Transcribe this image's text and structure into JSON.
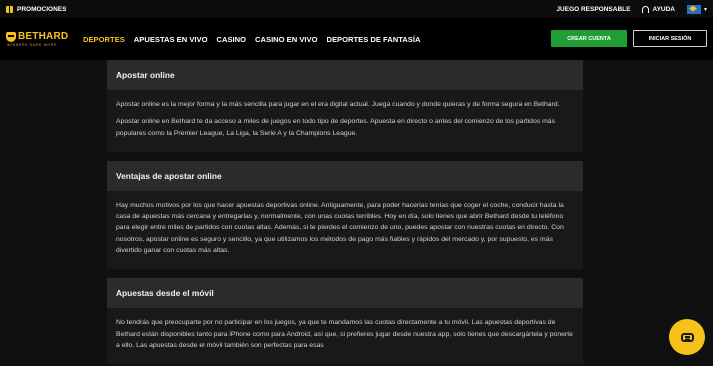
{
  "topbar": {
    "promo_label": "PROMOCIONES",
    "responsible_label": "JUEGO RESPONSABLE",
    "help_label": "AYUDA",
    "gift_icon": "gift-icon",
    "help_icon": "headset-icon",
    "language_icon": "flag-icon"
  },
  "brand": {
    "name": "BETHARD",
    "tagline": "WINNERS DARE MORE",
    "accent": "#f6c21a"
  },
  "nav": {
    "items": [
      {
        "label": "DEPORTES",
        "active": true
      },
      {
        "label": "APUESTAS EN VIVO",
        "active": false
      },
      {
        "label": "CASINO",
        "active": false
      },
      {
        "label": "CASINO EN VIVO",
        "active": false
      },
      {
        "label": "DEPORTES DE FANTASÍA",
        "active": false
      }
    ],
    "create_account_label": "CREAR CUENTA",
    "login_label": "INICIAR SESIÓN",
    "create_color": "#1f9e36"
  },
  "sections": [
    {
      "title": "Apostar online",
      "paragraphs": [
        "Apostar online es la mejor forma y la más sencilla para jugar en el era digital actual. Juega cuando y donde quieras y de forma segura en Bethard.",
        "Apostar online en Bethard te da acceso a miles de juegos en todo tipo de deportes. Apuesta en directo o antes del comienzo de los partidos más populares como la Premier League, La Liga, la Serie A y la Champions League."
      ]
    },
    {
      "title": "Ventajas de apostar online",
      "paragraphs": [
        "Hay muchos motivos por los que hacer apuestas deportivas online. Antiguamente, para poder hacerlas tenías que coger el coche, conducir hasta la casa de apuestas más cercana y entregarlas y, normalmente, con unas cuotas terribles. Hoy en día, solo tienes que abrir Bethard desde tu teléfono para elegir entre miles de partidos con cuotas altas. Además, si te pierdes el comienzo de uno, puedes apostar con nuestras cuotas en directo. Con nosotros, apostar online es seguro y sencillo, ya que utilizamos los métodos de pago más fiables y rápidos del mercado y, por supuesto, es más divertido ganar con cuotas más altas."
      ]
    },
    {
      "title": "Apuestas desde el móvil",
      "paragraphs": [
        "No tendrás que preocuparte por no participar en los juegos, ya que te mandamos las cuotas directamente a tu móvil. Las apuestas deportivas de Bethard están disponibles tanto para iPhone como para Android, así que, si prefieres jugar desde nuestra app, solo tienes que descargártela y ponerte a ello. Las apuestas desde el móvil también son perfectas para esas"
      ]
    }
  ],
  "chat": {
    "icon": "chat-icon"
  }
}
